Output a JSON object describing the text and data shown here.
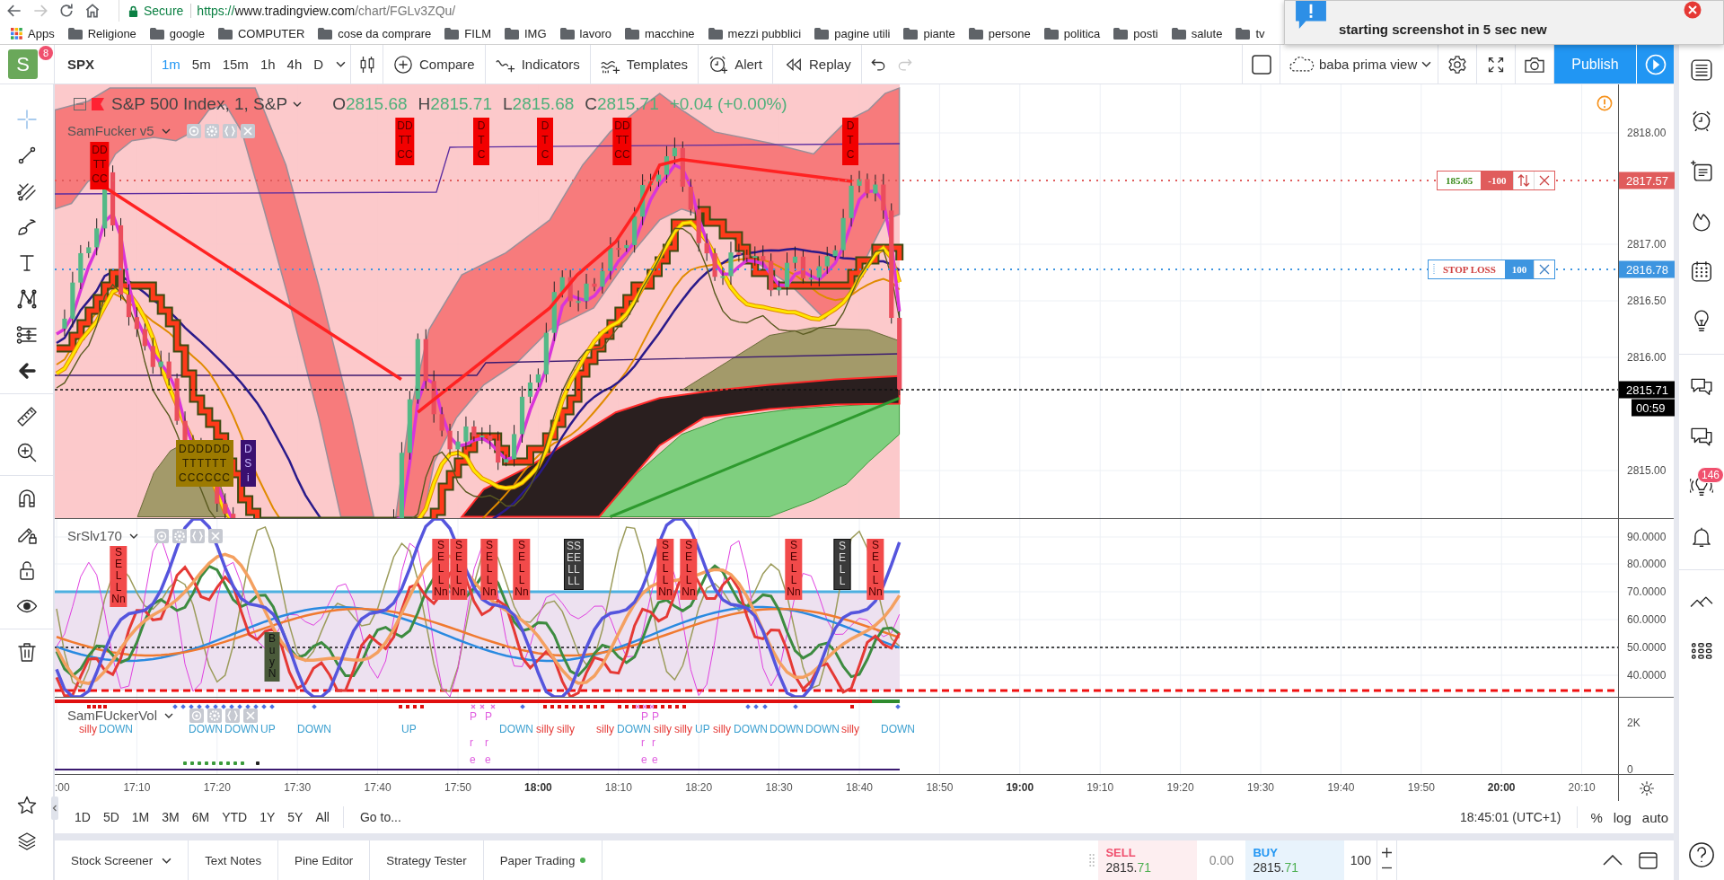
{
  "browser": {
    "nav_buttons": [
      {
        "kind": "back",
        "disabled": false
      },
      {
        "kind": "forward",
        "disabled": true
      },
      {
        "kind": "reload",
        "disabled": false
      },
      {
        "kind": "home",
        "disabled": false
      }
    ],
    "address": {
      "security": "Secure",
      "scheme": "https://",
      "host": "www.tradingview.com",
      "path": "/chart/FGLv3ZQu/"
    },
    "bookmarks": [
      {
        "kind": "apps",
        "label": "Apps"
      },
      {
        "kind": "folder",
        "label": "Religione"
      },
      {
        "kind": "folder",
        "label": "google"
      },
      {
        "kind": "folder",
        "label": "COMPUTER"
      },
      {
        "kind": "folder",
        "label": "cose da comprare"
      },
      {
        "kind": "folder",
        "label": "FILM"
      },
      {
        "kind": "folder",
        "label": "IMG"
      },
      {
        "kind": "folder",
        "label": "lavoro"
      },
      {
        "kind": "folder",
        "label": "macchine"
      },
      {
        "kind": "folder",
        "label": "mezzi pubblici"
      },
      {
        "kind": "folder",
        "label": "pagine utili"
      },
      {
        "kind": "folder",
        "label": "piante"
      },
      {
        "kind": "folder",
        "label": "persone"
      },
      {
        "kind": "folder",
        "label": "politica"
      },
      {
        "kind": "folder",
        "label": "posti"
      },
      {
        "kind": "folder",
        "label": "salute"
      },
      {
        "kind": "folder",
        "label": "tv"
      }
    ]
  },
  "notification": {
    "text": "starting screenshot in 5 sec new"
  },
  "header": {
    "avatar": {
      "letter": "S",
      "badge": "8"
    },
    "symbol": "SPX",
    "intervals": [
      {
        "label": "1m",
        "selected": true
      },
      {
        "label": "5m",
        "selected": false
      },
      {
        "label": "15m",
        "selected": false
      },
      {
        "label": "1h",
        "selected": false
      },
      {
        "label": "4h",
        "selected": false
      },
      {
        "label": "D",
        "selected": false
      }
    ],
    "tools": [
      {
        "kind": "compare",
        "label": "Compare"
      },
      {
        "kind": "indicators",
        "label": "Indicators"
      },
      {
        "kind": "templates",
        "label": "Templates"
      },
      {
        "kind": "alert",
        "label": "Alert"
      },
      {
        "kind": "replay",
        "label": "Replay"
      }
    ],
    "history": [
      {
        "kind": "undo",
        "disabled": false
      },
      {
        "kind": "redo",
        "disabled": true
      }
    ],
    "layout_name": "baba prima view",
    "publish": "Publish"
  },
  "left_toolbar": {
    "groups": [
      [
        {
          "kind": "cursor",
          "selected": true
        },
        {
          "kind": "trend_line",
          "selected": false
        },
        {
          "kind": "fib",
          "selected": false
        },
        {
          "kind": "brush",
          "selected": false
        },
        {
          "kind": "text",
          "selected": false
        },
        {
          "kind": "pattern",
          "selected": false
        },
        {
          "kind": "forecast",
          "selected": false
        },
        {
          "kind": "back",
          "selected": false
        }
      ],
      [
        {
          "kind": "ruler",
          "selected": false
        },
        {
          "kind": "zoom",
          "selected": false
        }
      ],
      [
        {
          "kind": "magnet",
          "selected": false
        },
        {
          "kind": "drawing_lock",
          "selected": false
        },
        {
          "kind": "lock",
          "selected": false
        },
        {
          "kind": "eye",
          "selected": false
        }
      ],
      [
        {
          "kind": "trash",
          "selected": false
        }
      ]
    ],
    "bottom": [
      {
        "kind": "star",
        "selected": false
      },
      {
        "kind": "layers",
        "selected": false
      }
    ]
  },
  "chart": {
    "legend": {
      "title": "S&P 500 Index, 1, S&P",
      "ohlc": [
        {
          "key": "O",
          "value": "2815.68"
        },
        {
          "key": "H",
          "value": "2815.71"
        },
        {
          "key": "L",
          "value": "2815.68"
        },
        {
          "key": "C",
          "value": "2815.71"
        }
      ],
      "change": "+0.04 (+0.00%)"
    },
    "indicator": "SamFucker v5",
    "price_axis": [
      "2818.00",
      "2817.00",
      "2816.50",
      "2816.00",
      "2815.00"
    ],
    "price_tags": [
      {
        "kind": "position",
        "value": "2817.57"
      },
      {
        "kind": "stop",
        "value": "2816.78"
      },
      {
        "kind": "last",
        "value": "2815.71"
      },
      {
        "kind": "countdown",
        "value": "00:59"
      }
    ],
    "orders": [
      {
        "kind": "position",
        "label": "185.65",
        "quantity": "-100"
      },
      {
        "kind": "stop",
        "label": "STOP LOSS",
        "quantity": "100"
      }
    ],
    "markers": [
      {
        "kind": "dtc",
        "lines": [
          "DD",
          "TT",
          "CC"
        ]
      },
      {
        "kind": "dtc",
        "lines": [
          "DD",
          "TT",
          "CC"
        ]
      },
      {
        "kind": "dtc",
        "lines": [
          "D",
          "T",
          "C"
        ]
      },
      {
        "kind": "dtc",
        "lines": [
          "D",
          "T",
          "C"
        ]
      },
      {
        "kind": "dtc",
        "lines": [
          "DD",
          "TT",
          "CC"
        ]
      },
      {
        "kind": "dtc",
        "lines": [
          "D",
          "T",
          "C"
        ]
      },
      {
        "kind": "cluster",
        "lines": [
          "DDDDDD",
          "TTTTTT",
          "CCCCCC"
        ]
      },
      {
        "kind": "dsi",
        "lines": [
          "D",
          "S",
          "i"
        ]
      }
    ]
  },
  "oscillator": {
    "name": "SrSlv170",
    "axis": [
      "90.0000",
      "80.0000",
      "70.0000",
      "60.0000",
      "50.0000",
      "40.0000"
    ],
    "markers": [
      {
        "kind": "sell",
        "lines": [
          "S",
          "E",
          "L",
          "L",
          "Nn"
        ]
      },
      {
        "kind": "buy",
        "lines": [
          "B",
          "u",
          "y",
          "N"
        ]
      },
      {
        "kind": "sell",
        "lines": [
          "S",
          "E",
          "L",
          "L",
          "Nn"
        ]
      },
      {
        "kind": "sell",
        "lines": [
          "S",
          "E",
          "L",
          "L",
          "Nn"
        ]
      },
      {
        "kind": "sell",
        "lines": [
          "S",
          "E",
          "L",
          "L",
          "Nn"
        ]
      },
      {
        "kind": "sell",
        "lines": [
          "S",
          "E",
          "L",
          "L",
          "Nn"
        ]
      },
      {
        "kind": "sell_dark",
        "lines": [
          "SS",
          "EE",
          "LL",
          "LL"
        ]
      },
      {
        "kind": "sell",
        "lines": [
          "S",
          "E",
          "L",
          "L",
          "Nn"
        ]
      },
      {
        "kind": "sell",
        "lines": [
          "S",
          "E",
          "L",
          "L",
          "Nn"
        ]
      },
      {
        "kind": "sell",
        "lines": [
          "S",
          "E",
          "L",
          "L",
          "Nn"
        ]
      },
      {
        "kind": "sell_dark",
        "lines": [
          "S",
          "E",
          "L",
          "L"
        ]
      },
      {
        "kind": "sell",
        "lines": [
          "S",
          "E",
          "L",
          "L",
          "Nn"
        ]
      }
    ]
  },
  "volume": {
    "name": "SamFUckerVol",
    "axis": [
      "2K",
      "0"
    ],
    "labels": [
      {
        "kind": "silly",
        "text": "silly"
      },
      {
        "kind": "down",
        "text": "DOWN"
      },
      {
        "kind": "down",
        "text": "DOWN"
      },
      {
        "kind": "down",
        "text": "DOWN"
      },
      {
        "kind": "up",
        "text": "UP"
      },
      {
        "kind": "down",
        "text": "DOWN"
      },
      {
        "kind": "up",
        "text": "UP"
      },
      {
        "kind": "pre",
        "lines": [
          "P",
          "r",
          "e"
        ]
      },
      {
        "kind": "pre",
        "lines": [
          "P",
          "r",
          "e"
        ]
      },
      {
        "kind": "down",
        "text": "DOWN"
      },
      {
        "kind": "silly",
        "text": "silly"
      },
      {
        "kind": "silly",
        "text": "silly"
      },
      {
        "kind": "silly",
        "text": "silly"
      },
      {
        "kind": "down",
        "text": "DOWN"
      },
      {
        "kind": "pre",
        "lines": [
          "P",
          "r",
          "e"
        ]
      },
      {
        "kind": "pre",
        "lines": [
          "P",
          "r",
          "e"
        ]
      },
      {
        "kind": "silly",
        "text": "silly"
      },
      {
        "kind": "silly",
        "text": "silly"
      },
      {
        "kind": "up",
        "text": "UP"
      },
      {
        "kind": "silly",
        "text": "silly"
      },
      {
        "kind": "down",
        "text": "DOWN"
      },
      {
        "kind": "down",
        "text": "DOWN"
      },
      {
        "kind": "down",
        "text": "DOWN"
      },
      {
        "kind": "silly",
        "text": "silly"
      },
      {
        "kind": "down",
        "text": "DOWN"
      }
    ]
  },
  "time_axis": [
    {
      "label": ":00",
      "major": false
    },
    {
      "label": "17:10",
      "major": false
    },
    {
      "label": "17:20",
      "major": false
    },
    {
      "label": "17:30",
      "major": false
    },
    {
      "label": "17:40",
      "major": false
    },
    {
      "label": "17:50",
      "major": false
    },
    {
      "label": "18:00",
      "major": true
    },
    {
      "label": "18:10",
      "major": false
    },
    {
      "label": "18:20",
      "major": false
    },
    {
      "label": "18:30",
      "major": false
    },
    {
      "label": "18:40",
      "major": false
    },
    {
      "label": "18:50",
      "major": false
    },
    {
      "label": "19:00",
      "major": true
    },
    {
      "label": "19:10",
      "major": false
    },
    {
      "label": "19:20",
      "major": false
    },
    {
      "label": "19:30",
      "major": false
    },
    {
      "label": "19:40",
      "major": false
    },
    {
      "label": "19:50",
      "major": false
    },
    {
      "label": "20:00",
      "major": true
    },
    {
      "label": "20:10",
      "major": false
    }
  ],
  "range_bar": {
    "ranges": [
      "1D",
      "5D",
      "1M",
      "3M",
      "6M",
      "YTD",
      "1Y",
      "5Y",
      "All"
    ],
    "goto": "Go to...",
    "clock": "18:45:01 (UTC+1)",
    "scales": [
      "%",
      "log",
      "auto"
    ]
  },
  "bottom_panel": {
    "tabs": [
      {
        "kind": "dropdown",
        "label": "Stock Screener"
      },
      {
        "kind": "plain",
        "label": "Text Notes"
      },
      {
        "kind": "plain",
        "label": "Pine Editor"
      },
      {
        "kind": "plain",
        "label": "Strategy Tester"
      },
      {
        "kind": "status",
        "label": "Paper Trading",
        "connected": true
      }
    ],
    "sell": {
      "label": "SELL",
      "price": "2815.",
      "price_tail": "71"
    },
    "spread": "0.00",
    "buy": {
      "label": "BUY",
      "price": "2815.",
      "price_tail": "71"
    },
    "quantity": "100"
  },
  "right_sidebar": {
    "groups": [
      [
        {
          "kind": "watchlist"
        },
        {
          "kind": "alerts"
        },
        {
          "kind": "data_window"
        },
        {
          "kind": "hotlists"
        },
        {
          "kind": "calendar"
        },
        {
          "kind": "ideas"
        }
      ],
      [
        {
          "kind": "chats"
        },
        {
          "kind": "private_chats"
        },
        {
          "kind": "ideas_stream",
          "badge": "146"
        },
        {
          "kind": "notifications"
        }
      ],
      [
        {
          "kind": "order_panel"
        },
        {
          "kind": "dom"
        }
      ]
    ],
    "bottom": [
      {
        "kind": "help"
      }
    ]
  }
}
